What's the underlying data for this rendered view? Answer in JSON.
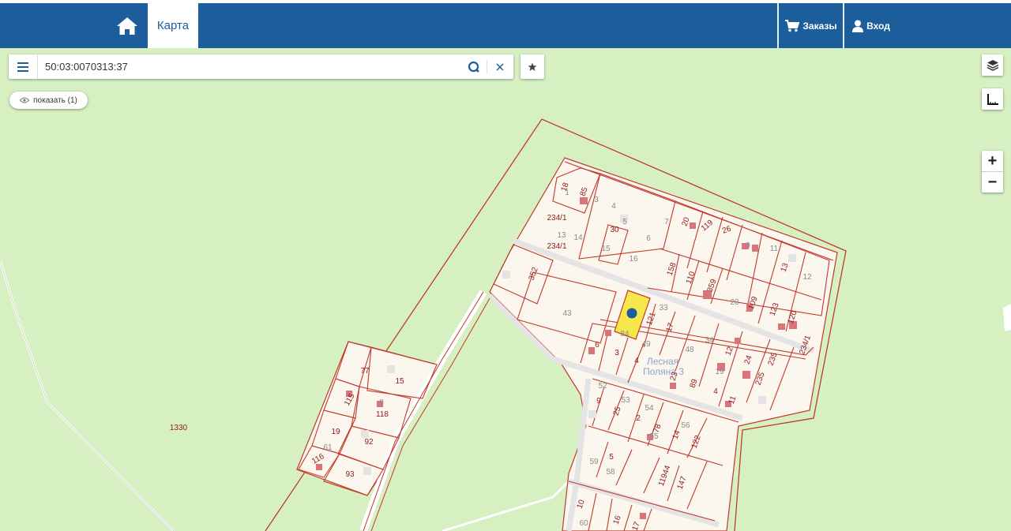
{
  "header": {
    "home_icon": "home-icon",
    "tab_map": "Карта",
    "orders_label": "Заказы",
    "orders_icon": "cart-icon",
    "login_label": "Вход",
    "login_icon": "user-icon",
    "bg_color": "#1c5d9b"
  },
  "search": {
    "value": "50:03:0070313:37",
    "menu_icon": "menu-icon",
    "search_icon": "search-icon",
    "clear_icon": "close-icon",
    "favorite_icon": "star-icon"
  },
  "show_button": {
    "label": "показать (1)",
    "icon": "eye-icon"
  },
  "controls": {
    "layers_icon": "layers-icon",
    "measure_icon": "ruler-icon",
    "zoom_in": "+",
    "zoom_out": "−"
  },
  "map": {
    "place_name_line1": "Лесная",
    "place_name_line2": "Поляна 3",
    "highlight_color": "#f6e84a",
    "boundary_color": "#c0392b",
    "plot_labels": [
      "18",
      "1",
      "85",
      "3",
      "4",
      "5",
      "7",
      "20",
      "119",
      "26",
      "9",
      "11",
      "234/1",
      "13",
      "14",
      "30",
      "15",
      "16",
      "6",
      "234/1",
      "158",
      "110",
      "359",
      "20",
      "109",
      "123",
      "120",
      "13",
      "12",
      "352",
      "43",
      "33",
      "121",
      "17",
      "84",
      "6",
      "49",
      "3",
      "4",
      "48",
      "34",
      "12",
      "24",
      "235",
      "234/1",
      "23",
      "89",
      "19",
      "4",
      "11",
      "235",
      "52",
      "53",
      "9",
      "25",
      "54",
      "2",
      "78",
      "56",
      "14",
      "122",
      "55",
      "5",
      "59",
      "58",
      "11944",
      "147",
      "10",
      "16",
      "60",
      "17",
      "77",
      "15",
      "115",
      "8",
      "118",
      "19",
      "92",
      "116",
      "61",
      "93",
      "1330"
    ]
  }
}
